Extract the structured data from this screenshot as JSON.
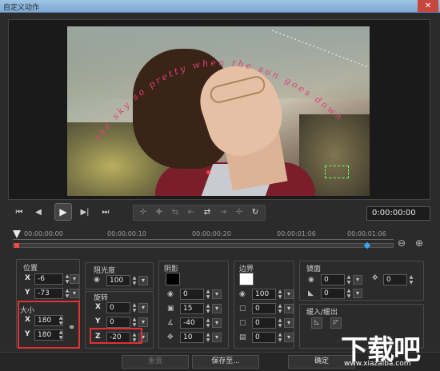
{
  "window": {
    "title": "自定义动作",
    "close_glyph": "✕"
  },
  "preview": {
    "overlay_text": "the sky so pretty when the sun goes down",
    "timecode": "0:00:00:00"
  },
  "transport": {
    "home": "⏮",
    "prev_frame": "◀",
    "play": "▶",
    "next_frame": "▶|",
    "end": "⏭"
  },
  "timeline": {
    "ticks": [
      "00:00:00:00",
      "00:00:00:10",
      "00:00:00:20",
      "00:00:01:06",
      "00:00:01:06"
    ],
    "zoom_out": "⊖",
    "zoom_in": "⊕"
  },
  "position": {
    "label": "位置",
    "x_label": "X",
    "x_value": "-6",
    "y_label": "Y",
    "y_value": "-73"
  },
  "size": {
    "label": "大小",
    "x_label": "X",
    "x_value": "180",
    "y_label": "Y",
    "y_value": "180"
  },
  "opacity": {
    "label": "阻光度",
    "value": "100"
  },
  "rotation": {
    "label": "旋转",
    "x_label": "X",
    "x_value": "0",
    "y_label": "Y",
    "y_value": "0",
    "z_label": "Z",
    "z_value": "-20"
  },
  "shadow": {
    "label": "阴影",
    "v1": "0",
    "v2": "15",
    "v3": "-40",
    "v4": "10"
  },
  "border": {
    "label": "边界",
    "v1": "100",
    "v2": "0",
    "v3": "0",
    "v4": "0"
  },
  "mirror": {
    "label": "镜面",
    "v1": "0",
    "v2": "0",
    "v3": "0"
  },
  "fade": {
    "label": "缓入/缓出"
  },
  "buttons": {
    "reset": "重置",
    "save_as": "保存至...",
    "ok": "确定"
  },
  "watermark": {
    "big": "下载吧",
    "small": "www.xiazaiba.com"
  },
  "colors": {
    "highlight": "#e23131",
    "keyframe_start": "#ff4646",
    "keyframe_end": "#35a7ff"
  }
}
